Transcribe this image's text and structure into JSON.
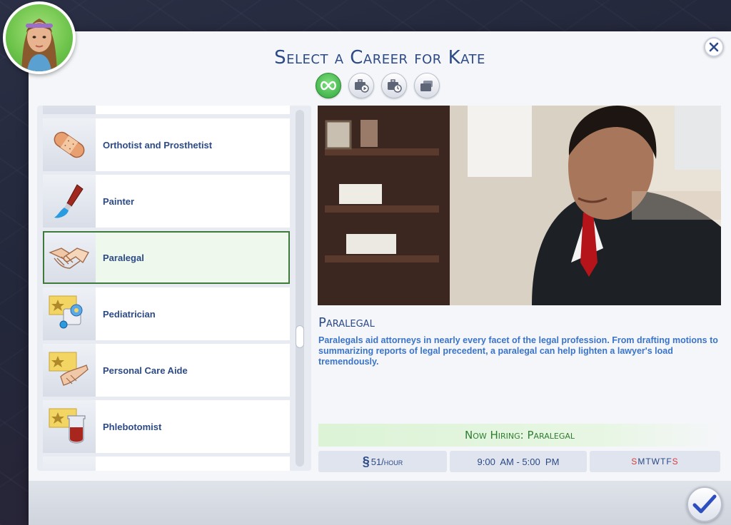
{
  "dialog": {
    "title": "Select a Career for Kate",
    "sim_name": "Kate"
  },
  "filters": [
    {
      "name": "all-careers",
      "icon": "infinity-icon",
      "active": true
    },
    {
      "name": "part-time",
      "icon": "briefcase-play-icon",
      "active": false
    },
    {
      "name": "full-time",
      "icon": "briefcase-clock-icon",
      "active": false
    },
    {
      "name": "freelance",
      "icon": "briefcase-stack-icon",
      "active": false
    }
  ],
  "careers": [
    {
      "label": "Orthotist and Prosthetist",
      "icon": "bandage-icon"
    },
    {
      "label": "Painter",
      "icon": "paintbrush-icon"
    },
    {
      "label": "Paralegal",
      "icon": "handshake-icon",
      "selected": true
    },
    {
      "label": "Pediatrician",
      "icon": "pediatrician-icon"
    },
    {
      "label": "Personal Care Aide",
      "icon": "care-hands-icon"
    },
    {
      "label": "Phlebotomist",
      "icon": "blood-vial-icon"
    }
  ],
  "detail": {
    "title": "Paralegal",
    "description": "Paralegals aid attorneys in nearly every facet of the legal profession. From drafting motions to summarizing reports of legal precedent, a paralegal can help lighten a lawyer's load tremendously.",
    "hiring": "Now Hiring: Paralegal",
    "pay_symbol": "§",
    "pay": "51/hour",
    "hours": "9:00  AM - 5:00  PM",
    "days": [
      {
        "letter": "S",
        "off": true
      },
      {
        "letter": "M",
        "off": false
      },
      {
        "letter": "T",
        "off": false
      },
      {
        "letter": "W",
        "off": false
      },
      {
        "letter": "T",
        "off": false
      },
      {
        "letter": "F",
        "off": false
      },
      {
        "letter": "S",
        "off": true
      }
    ]
  },
  "colors": {
    "title_blue": "#2c4a86",
    "desc_blue": "#3a74c9",
    "hiring_green": "#2f7d32",
    "day_off_red": "#d93a3a",
    "selected_border": "#3e7a3a"
  }
}
